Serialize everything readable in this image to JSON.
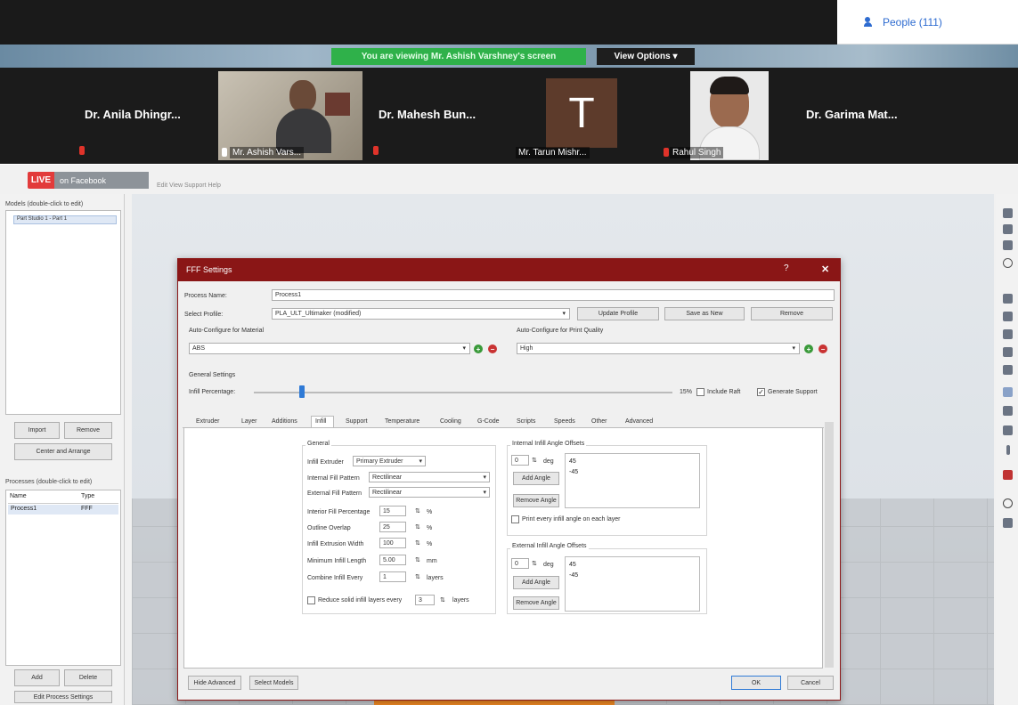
{
  "zoom": {
    "people_label": "People (111)",
    "viewing_label": "You are viewing Mr. Ashish Varshney's screen",
    "view_options_label": "View Options ▾",
    "participants": [
      {
        "name": "Dr. Anila Dhingr..."
      },
      {
        "name": "Mr. Ashish Vars..."
      },
      {
        "name": "Dr. Mahesh Bun..."
      },
      {
        "name": "Mr. Tarun Mishr...",
        "initial": "T"
      },
      {
        "name": "Rahul Singh"
      },
      {
        "name": "Dr. Garima Mat..."
      }
    ]
  },
  "stream": {
    "live_label": "LIVE",
    "platform_label": "on Facebook"
  },
  "app": {
    "menu_label": "Edit   View   Support   Help",
    "models_label": "Models (double-click to edit)",
    "models_item": "Part Studio 1 - Part 1",
    "import_label": "Import",
    "remove_label": "Remove",
    "center_label": "Center and Arrange",
    "processes_label": "Processes (double-click to edit)",
    "col_name": "Name",
    "col_type": "Type",
    "process_name": "Process1",
    "process_type": "FFF",
    "add_label": "Add",
    "delete_label": "Delete",
    "edit_process_label": "Edit Process Settings"
  },
  "dialog": {
    "title": "FFF Settings",
    "help": "?",
    "close": "✕",
    "process_name_label": "Process Name:",
    "process_name_value": "Process1",
    "select_profile_label": "Select Profile:",
    "select_profile_value": "PLA_ULT_Ultimaker (modified)",
    "update_profile": "Update Profile",
    "save_as_new": "Save as New",
    "remove": "Remove",
    "auto_material_label": "Auto-Configure for Material",
    "auto_material_value": "ABS",
    "auto_quality_label": "Auto-Configure for Print Quality",
    "auto_quality_value": "High",
    "general_label": "General Settings",
    "infill_pct_label": "Infill Percentage:",
    "infill_pct_value": "15%",
    "include_raft": "Include Raft",
    "generate_support": "Generate Support",
    "tabs": [
      "Extruder",
      "Layer",
      "Additions",
      "Infill",
      "Support",
      "Temperature",
      "Cooling",
      "G-Code",
      "Scripts",
      "Speeds",
      "Other",
      "Advanced"
    ],
    "infill": {
      "general_label": "General",
      "extruder_label": "Infill Extruder",
      "extruder_value": "Primary Extruder",
      "internal_pattern_label": "Internal Fill Pattern",
      "internal_pattern_value": "Rectilinear",
      "external_pattern_label": "External Fill Pattern",
      "external_pattern_value": "Rectilinear",
      "pct_label": "Interior Fill Percentage",
      "pct_value": "15",
      "pct_unit": "%",
      "outline_label": "Outline Overlap",
      "outline_value": "25",
      "outline_unit": "%",
      "width_label": "Infill Extrusion Width",
      "width_value": "100",
      "width_unit": "%",
      "min_length_label": "Minimum Infill Length",
      "min_length_value": "5.00",
      "min_length_unit": "mm",
      "combine_label": "Combine Infill Every",
      "combine_value": "1",
      "combine_unit": "layers",
      "reduce_label": "Reduce solid infill layers every",
      "reduce_value": "3",
      "reduce_unit": "layers",
      "internal_angles_label": "Internal Infill Angle Offsets",
      "internal_angle_value": "0",
      "deg_unit": "deg",
      "internal_angles": [
        "45",
        "-45"
      ],
      "add_angle": "Add Angle",
      "remove_angle": "Remove Angle",
      "print_every_label": "Print every infill angle on each layer",
      "external_angles_label": "External Infill Angle Offsets",
      "external_angle_value": "0",
      "external_angles": [
        "45",
        "-45"
      ]
    },
    "hide_advanced": "Hide Advanced",
    "select_models": "Select Models",
    "ok": "OK",
    "cancel": "Cancel"
  }
}
